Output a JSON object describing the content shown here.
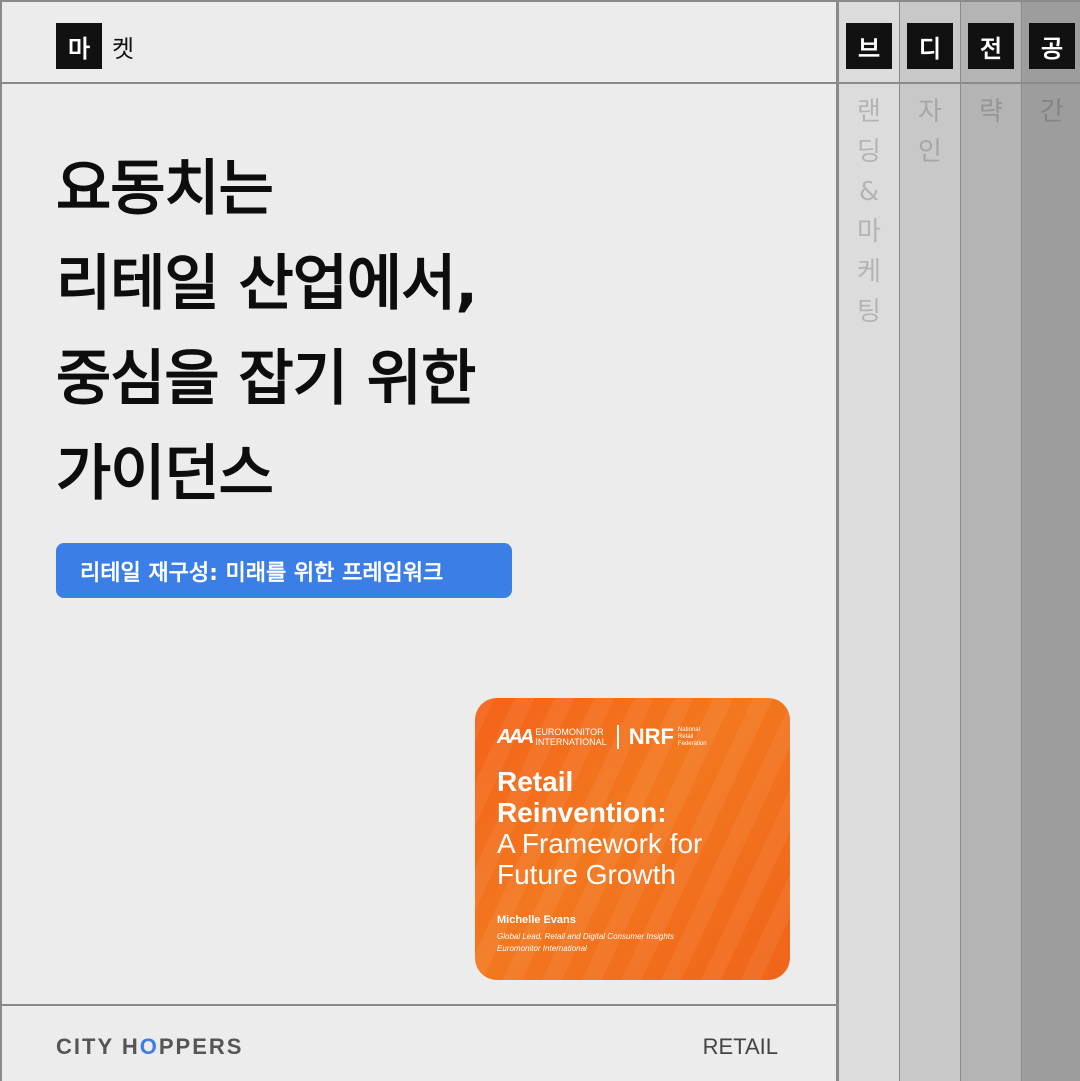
{
  "tabs": {
    "active": {
      "first_char": "마",
      "rest": "켓"
    },
    "side": [
      {
        "chip": "브",
        "vertical": [
          "랜",
          "딩",
          "&",
          "마",
          "케",
          "팅"
        ]
      },
      {
        "chip": "디",
        "vertical": [
          "자",
          "인"
        ]
      },
      {
        "chip": "전",
        "vertical": [
          "략"
        ]
      },
      {
        "chip": "공",
        "vertical": [
          "간"
        ]
      }
    ]
  },
  "headline": {
    "lines": [
      "요동치는",
      "리테일 산업에서,",
      "중심을 잡기 위한",
      "가이던스"
    ]
  },
  "subtitle": "리테일 재구성: 미래를 위한 프레임워크",
  "report": {
    "logo_mark": "AAA",
    "logo_euro_1": "EUROMONITOR",
    "logo_euro_2": "INTERNATIONAL",
    "logo_nrf": "NRF",
    "logo_nrf_1": "National",
    "logo_nrf_2": "Retail",
    "logo_nrf_3": "Federation",
    "title_bold_1": "Retail",
    "title_bold_2": "Reinvention:",
    "title_reg_1": "A Framework for",
    "title_reg_2": "Future Growth",
    "author": "Michelle Evans",
    "role_1": "Global Lead, Retail and Digital Consumer Insights",
    "role_2": "Euromonitor International"
  },
  "footer": {
    "brand_a": "CITY H",
    "brand_o": "O",
    "brand_b": "PPERS",
    "category": "RETAIL"
  },
  "colors": {
    "accent": "#3b7ee6",
    "report_orange": "#f2781f",
    "tag_black": "#111111"
  }
}
